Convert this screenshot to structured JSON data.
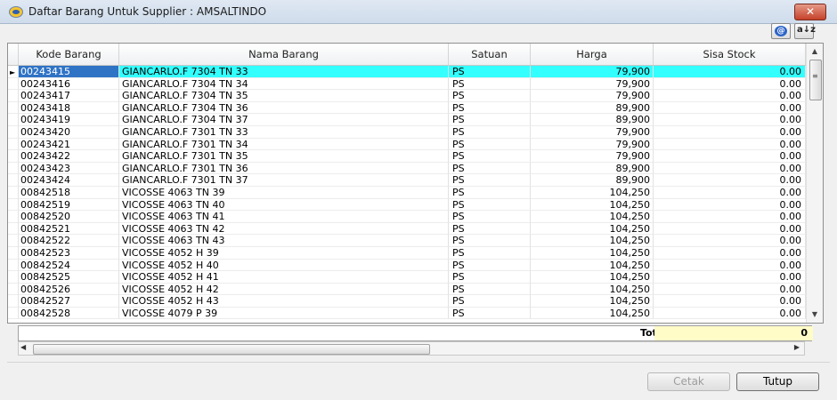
{
  "window": {
    "title": "Daftar Barang Untuk Supplier : AMSALTINDO",
    "close_glyph": "✕"
  },
  "toolbar": {
    "help_icon": "help-icon",
    "sort_icon": "sort-az-icon",
    "sort_text": "a↓z"
  },
  "grid": {
    "columns": [
      "Kode Barang",
      "Nama Barang",
      "Satuan",
      "Harga",
      "Sisa Stock"
    ],
    "selected_row": 0,
    "row_indicator": "►",
    "rows": [
      {
        "kode": "00243415",
        "nama": "GIANCARLO.F 7304 TN 33",
        "satuan": "PS",
        "harga": "79,900",
        "sisa": "0.00"
      },
      {
        "kode": "00243416",
        "nama": "GIANCARLO.F 7304 TN 34",
        "satuan": "PS",
        "harga": "79,900",
        "sisa": "0.00"
      },
      {
        "kode": "00243417",
        "nama": "GIANCARLO.F 7304 TN 35",
        "satuan": "PS",
        "harga": "79,900",
        "sisa": "0.00"
      },
      {
        "kode": "00243418",
        "nama": "GIANCARLO.F 7304 TN 36",
        "satuan": "PS",
        "harga": "89,900",
        "sisa": "0.00"
      },
      {
        "kode": "00243419",
        "nama": "GIANCARLO.F 7304 TN 37",
        "satuan": "PS",
        "harga": "89,900",
        "sisa": "0.00"
      },
      {
        "kode": "00243420",
        "nama": "GIANCARLO.F 7301 TN 33",
        "satuan": "PS",
        "harga": "79,900",
        "sisa": "0.00"
      },
      {
        "kode": "00243421",
        "nama": "GIANCARLO.F 7301 TN 34",
        "satuan": "PS",
        "harga": "79,900",
        "sisa": "0.00"
      },
      {
        "kode": "00243422",
        "nama": "GIANCARLO.F 7301 TN 35",
        "satuan": "PS",
        "harga": "79,900",
        "sisa": "0.00"
      },
      {
        "kode": "00243423",
        "nama": "GIANCARLO.F 7301 TN 36",
        "satuan": "PS",
        "harga": "89,900",
        "sisa": "0.00"
      },
      {
        "kode": "00243424",
        "nama": "GIANCARLO.F 7301 TN 37",
        "satuan": "PS",
        "harga": "89,900",
        "sisa": "0.00"
      },
      {
        "kode": "00842518",
        "nama": "VICOSSE 4063 TN 39",
        "satuan": "PS",
        "harga": "104,250",
        "sisa": "0.00"
      },
      {
        "kode": "00842519",
        "nama": "VICOSSE 4063 TN 40",
        "satuan": "PS",
        "harga": "104,250",
        "sisa": "0.00"
      },
      {
        "kode": "00842520",
        "nama": "VICOSSE 4063 TN 41",
        "satuan": "PS",
        "harga": "104,250",
        "sisa": "0.00"
      },
      {
        "kode": "00842521",
        "nama": "VICOSSE 4063 TN 42",
        "satuan": "PS",
        "harga": "104,250",
        "sisa": "0.00"
      },
      {
        "kode": "00842522",
        "nama": "VICOSSE 4063 TN 43",
        "satuan": "PS",
        "harga": "104,250",
        "sisa": "0.00"
      },
      {
        "kode": "00842523",
        "nama": "VICOSSE 4052 H 39",
        "satuan": "PS",
        "harga": "104,250",
        "sisa": "0.00"
      },
      {
        "kode": "00842524",
        "nama": "VICOSSE 4052 H 40",
        "satuan": "PS",
        "harga": "104,250",
        "sisa": "0.00"
      },
      {
        "kode": "00842525",
        "nama": "VICOSSE 4052 H 41",
        "satuan": "PS",
        "harga": "104,250",
        "sisa": "0.00"
      },
      {
        "kode": "00842526",
        "nama": "VICOSSE 4052 H 42",
        "satuan": "PS",
        "harga": "104,250",
        "sisa": "0.00"
      },
      {
        "kode": "00842527",
        "nama": "VICOSSE 4052 H 43",
        "satuan": "PS",
        "harga": "104,250",
        "sisa": "0.00"
      },
      {
        "kode": "00842528",
        "nama": "VICOSSE 4079 P 39",
        "satuan": "PS",
        "harga": "104,250",
        "sisa": "0.00"
      }
    ]
  },
  "footer": {
    "total_label": "Total",
    "total_value": "0"
  },
  "buttons": {
    "cetak": "Cetak",
    "tutup": "Tutup"
  },
  "colors": {
    "selected_row": "#33ffff",
    "selected_cell": "#2f73c5",
    "total_bg": "#fffcc8"
  }
}
